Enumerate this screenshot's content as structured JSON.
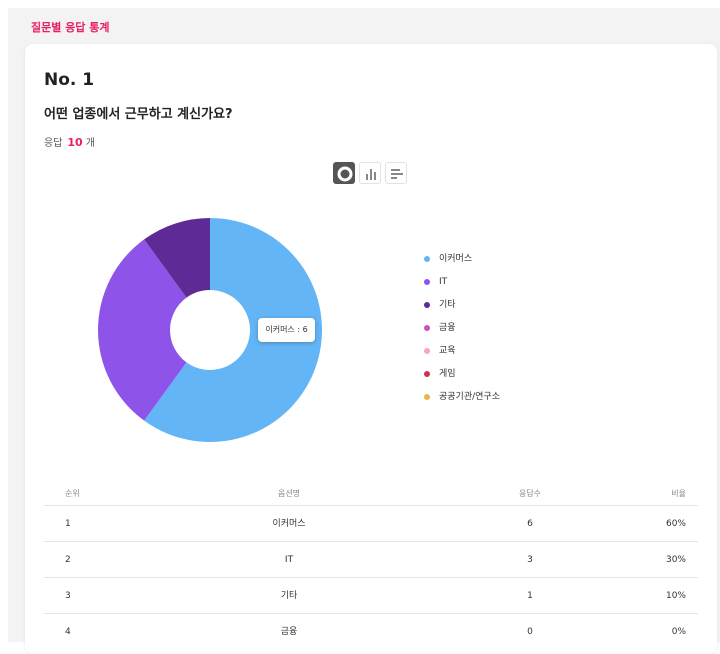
{
  "section": {
    "title": "질문별 응답 통계"
  },
  "question": {
    "number": "No. 1",
    "text": "어떤 업종에서 근무하고 계신가요?",
    "response_prefix": "응답",
    "response_count": "10",
    "response_suffix": "개"
  },
  "view_toggles": [
    "donut-chart-icon",
    "bar-chart-icon",
    "horizontal-bar-chart-icon"
  ],
  "tooltip": {
    "text": "이커머스 : 6"
  },
  "chart_data": {
    "type": "pie",
    "title": "",
    "categories": [
      "이커머스",
      "IT",
      "기타",
      "금융",
      "교육",
      "게임",
      "공공기관/연구소"
    ],
    "values": [
      6,
      3,
      1,
      0,
      0,
      0,
      0
    ],
    "colors": [
      "#64b5f6",
      "#8e54e9",
      "#5e2a96",
      "#c850c0",
      "#f8a5c2",
      "#d32f4f",
      "#e6b84c"
    ],
    "legend_position": "right"
  },
  "table": {
    "headers": {
      "rank": "순위",
      "name": "옵션명",
      "count": "응답수",
      "ratio": "비율"
    },
    "rows": [
      {
        "rank": "1",
        "name": "이커머스",
        "count": "6",
        "ratio": "60%"
      },
      {
        "rank": "2",
        "name": "IT",
        "count": "3",
        "ratio": "30%"
      },
      {
        "rank": "3",
        "name": "기타",
        "count": "1",
        "ratio": "10%"
      },
      {
        "rank": "4",
        "name": "금융",
        "count": "0",
        "ratio": "0%"
      }
    ]
  }
}
